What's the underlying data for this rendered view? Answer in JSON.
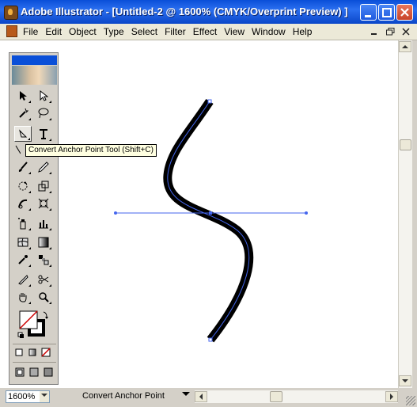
{
  "window": {
    "title": "Adobe Illustrator - [Untitled-2 @ 1600% (CMYK/Overprint Preview) ]"
  },
  "menu": {
    "items": [
      "File",
      "Edit",
      "Object",
      "Type",
      "Select",
      "Filter",
      "Effect",
      "View",
      "Window",
      "Help"
    ]
  },
  "tooltip": {
    "text": "Convert Anchor Point Tool (Shift+C)"
  },
  "status": {
    "zoom": "1600%",
    "current_tool": "Convert Anchor Point"
  },
  "icons": {
    "selected_tool": "convert-anchor-point-icon",
    "fill_color": "#ffffff",
    "stroke_color": "#000000",
    "accent": "#0a4fd8",
    "path_highlight": "#3355dd"
  }
}
